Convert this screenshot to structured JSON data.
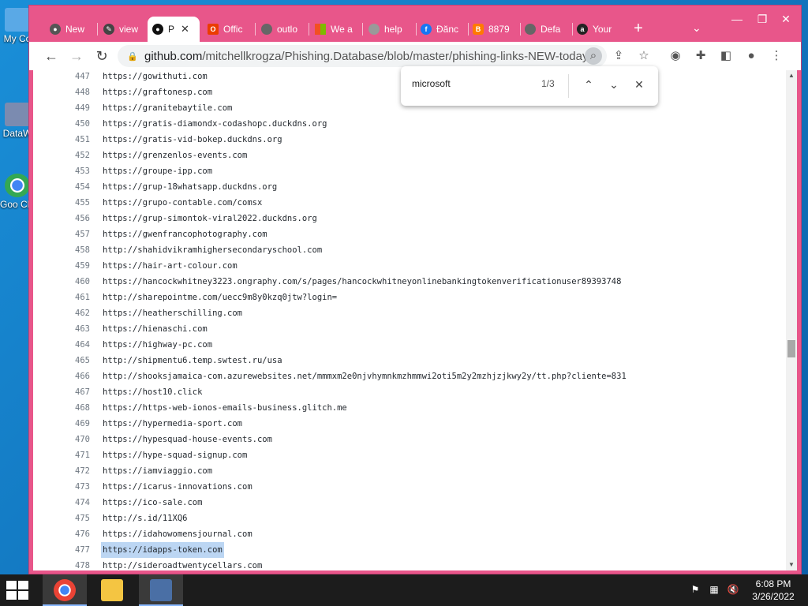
{
  "desktop": {
    "icons": [
      {
        "label": "My Co",
        "color": "#5aa9e6"
      },
      {
        "label": "DataW",
        "color": "#7b8bb0"
      },
      {
        "label": "Goo Chr",
        "color": "#34a853"
      }
    ]
  },
  "tabs": [
    {
      "label": "New",
      "icon": "chrome-icon",
      "color": "#555"
    },
    {
      "label": "view",
      "icon": "tool-icon",
      "color": "#444"
    },
    {
      "label": "P",
      "icon": "github-icon",
      "color": "#111",
      "active": true,
      "close": "✕"
    },
    {
      "label": "Offic",
      "icon": "office-icon",
      "color": "#eb3c00"
    },
    {
      "label": "outlo",
      "icon": "globe-icon",
      "color": "#666"
    },
    {
      "label": "We a",
      "icon": "microsoft-icon",
      "color": "#f25022"
    },
    {
      "label": "help",
      "icon": "globe-icon",
      "color": "#999"
    },
    {
      "label": "Đănc",
      "icon": "facebook-icon",
      "color": "#1877f2"
    },
    {
      "label": "8879",
      "icon": "blogger-icon",
      "color": "#ff7a00"
    },
    {
      "label": "Defa",
      "icon": "globe-icon",
      "color": "#666"
    },
    {
      "label": "Your",
      "icon": "amazon-icon",
      "color": "#222"
    }
  ],
  "tabstrip": {
    "new_tab": "+",
    "menu": "⌄"
  },
  "window_controls": {
    "minimize": "—",
    "maximize": "❐",
    "close": "✕"
  },
  "toolbar": {
    "back": "←",
    "forward": "→",
    "reload": "↻",
    "url_host": "github.com",
    "url_path": "/mitchellkrogza/Phishing.Database/blob/master/phishing-links-NEW-today...."
  },
  "find": {
    "query": "microsoft",
    "count": "1/3",
    "prev": "⌃",
    "next": "⌄",
    "close": "✕"
  },
  "code_lines": [
    {
      "n": "447",
      "t": "https://gowithuti.com"
    },
    {
      "n": "448",
      "t": "https://graftonesp.com"
    },
    {
      "n": "449",
      "t": "https://granitebaytile.com"
    },
    {
      "n": "450",
      "t": "https://gratis-diamondx-codashopc.duckdns.org"
    },
    {
      "n": "451",
      "t": "https://gratis-vid-bokep.duckdns.org"
    },
    {
      "n": "452",
      "t": "https://grenzenlos-events.com"
    },
    {
      "n": "453",
      "t": "https://groupe-ipp.com"
    },
    {
      "n": "454",
      "t": "https://grup-18whatsapp.duckdns.org"
    },
    {
      "n": "455",
      "t": "https://grupo-contable.com/comsx"
    },
    {
      "n": "456",
      "t": "https://grup-simontok-viral2022.duckdns.org"
    },
    {
      "n": "457",
      "t": "https://gwenfrancophotography.com"
    },
    {
      "n": "458",
      "t": "http://shahidvikramhighersecondaryschool.com"
    },
    {
      "n": "459",
      "t": "https://hair-art-colour.com"
    },
    {
      "n": "460",
      "t": "https://hancockwhitney3223.ongraphy.com/s/pages/hancockwhitneyonlinebankingtokenverificationuser89393748"
    },
    {
      "n": "461",
      "t": "http://sharepointme.com/uecc9m8y0kzq0jtw?login="
    },
    {
      "n": "462",
      "t": "https://heatherschilling.com"
    },
    {
      "n": "463",
      "t": "https://hienaschi.com"
    },
    {
      "n": "464",
      "t": "https://highway-pc.com"
    },
    {
      "n": "465",
      "t": "http://shipmentu6.temp.swtest.ru/usa"
    },
    {
      "n": "466",
      "t": "http://shooksjamaica-com.azurewebsites.net/mmmxm2e0njvhymnkmzhmmwi2oti5m2y2mzhjzjkwy2y/tt.php?cliente=831"
    },
    {
      "n": "467",
      "t": "https://host10.click"
    },
    {
      "n": "468",
      "t": "https://https-web-ionos-emails-business.glitch.me"
    },
    {
      "n": "469",
      "t": "https://hypermedia-sport.com"
    },
    {
      "n": "470",
      "t": "https://hypesquad-house-events.com"
    },
    {
      "n": "471",
      "t": "https://hype-squad-signup.com"
    },
    {
      "n": "472",
      "t": "https://iamviaggio.com"
    },
    {
      "n": "473",
      "t": "https://icarus-innovations.com"
    },
    {
      "n": "474",
      "t": "https://ico-sale.com"
    },
    {
      "n": "475",
      "t": "http://s.id/11XQ6"
    },
    {
      "n": "476",
      "t": "https://idahowomensjournal.com"
    },
    {
      "n": "477",
      "t": "https://idapps-token.com",
      "highlight": true
    },
    {
      "n": "478",
      "t": "http://sideroadtwentycellars.com"
    }
  ],
  "taskbar": {
    "clock_time": "6:08 PM",
    "clock_date": "3/26/2022"
  }
}
